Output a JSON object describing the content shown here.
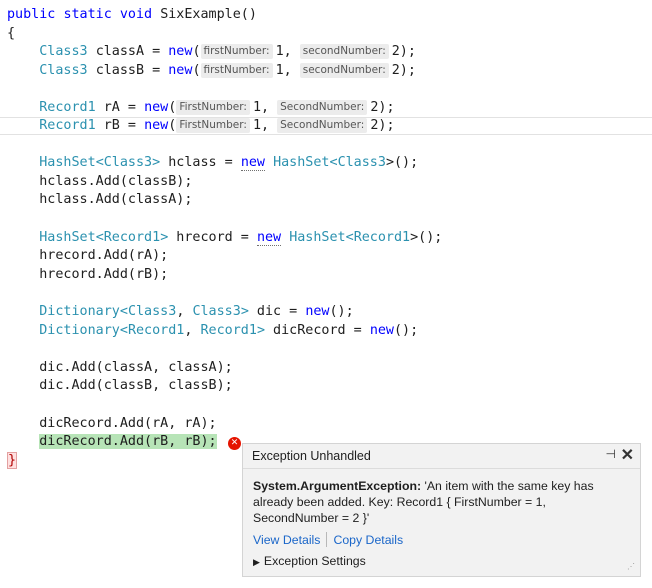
{
  "code": {
    "l1": {
      "public": "public",
      "static": "static",
      "void": "void",
      "name": "SixExample()"
    },
    "l2": {
      "brace": "{"
    },
    "l3": {
      "type": "Class3",
      "var": "classA =",
      "new": "new",
      "open": "(",
      "h1": "firstNumber:",
      "v1": "1,",
      "h2": "secondNumber:",
      "v2": "2);"
    },
    "l4": {
      "type": "Class3",
      "var": "classB =",
      "new": "new",
      "open": "(",
      "h1": "firstNumber:",
      "v1": "1,",
      "h2": "secondNumber:",
      "v2": "2);"
    },
    "l6": {
      "type": "Record1",
      "var": "rA =",
      "new": "new",
      "open": "(",
      "h1": "FirstNumber:",
      "v1": "1,",
      "h2": "SecondNumber:",
      "v2": "2);"
    },
    "l7": {
      "type": "Record1",
      "var": "rB =",
      "new": "new",
      "open": "(",
      "h1": "FirstNumber:",
      "v1": "1,",
      "h2": "SecondNumber:",
      "v2": "2);"
    },
    "l9": {
      "t1": "HashSet",
      "lt": "<",
      "t2": "Class3",
      "gt": ">",
      "var": " hclass = ",
      "new": "new",
      "t3": "HashSet",
      "lt2": "<",
      "t4": "Class3",
      "end": ">();"
    },
    "l10": {
      "text": "hclass.Add(classB);"
    },
    "l11": {
      "text": "hclass.Add(classA);"
    },
    "l13": {
      "t1": "HashSet",
      "lt": "<",
      "t2": "Record1",
      "gt": ">",
      "var": " hrecord = ",
      "new": "new",
      "t3": "HashSet",
      "lt2": "<",
      "t4": "Record1",
      "end": ">();"
    },
    "l14": {
      "text": "hrecord.Add(rA);"
    },
    "l15": {
      "text": "hrecord.Add(rB);"
    },
    "l17": {
      "t1": "Dictionary",
      "lt": "<",
      "t2": "Class3",
      "comma": ", ",
      "t3": "Class3",
      "gt": ">",
      "var": " dic = ",
      "new": "new",
      "end": "();"
    },
    "l18": {
      "t1": "Dictionary",
      "lt": "<",
      "t2": "Record1",
      "comma": ", ",
      "t3": "Record1",
      "gt": ">",
      "var": " dicRecord = ",
      "new": "new",
      "end": "();"
    },
    "l20": {
      "text": "dic.Add(classA, classA);"
    },
    "l21": {
      "text": "dic.Add(classB, classB);"
    },
    "l23": {
      "text": "dicRecord.Add(rA, rA);"
    },
    "l24": {
      "text": "dicRecord.Add(rB, rB);"
    },
    "l25": {
      "brace": "}"
    }
  },
  "exception": {
    "title": "Exception Unhandled",
    "type": "System.ArgumentException:",
    "message": " 'An item with the same key has already been added. Key: Record1 { FirstNumber = 1, SecondNumber = 2 }'",
    "view_details": "View Details",
    "copy_details": "Copy Details",
    "settings": "Exception Settings",
    "pin_glyph": "⊣",
    "close_glyph": "✕",
    "error_glyph": "✕"
  },
  "colors": {
    "keyword": "#0000ff",
    "type": "#2b91af",
    "highlight": "#b7e4b7",
    "link": "#1a66c9",
    "error": "#e51400"
  }
}
